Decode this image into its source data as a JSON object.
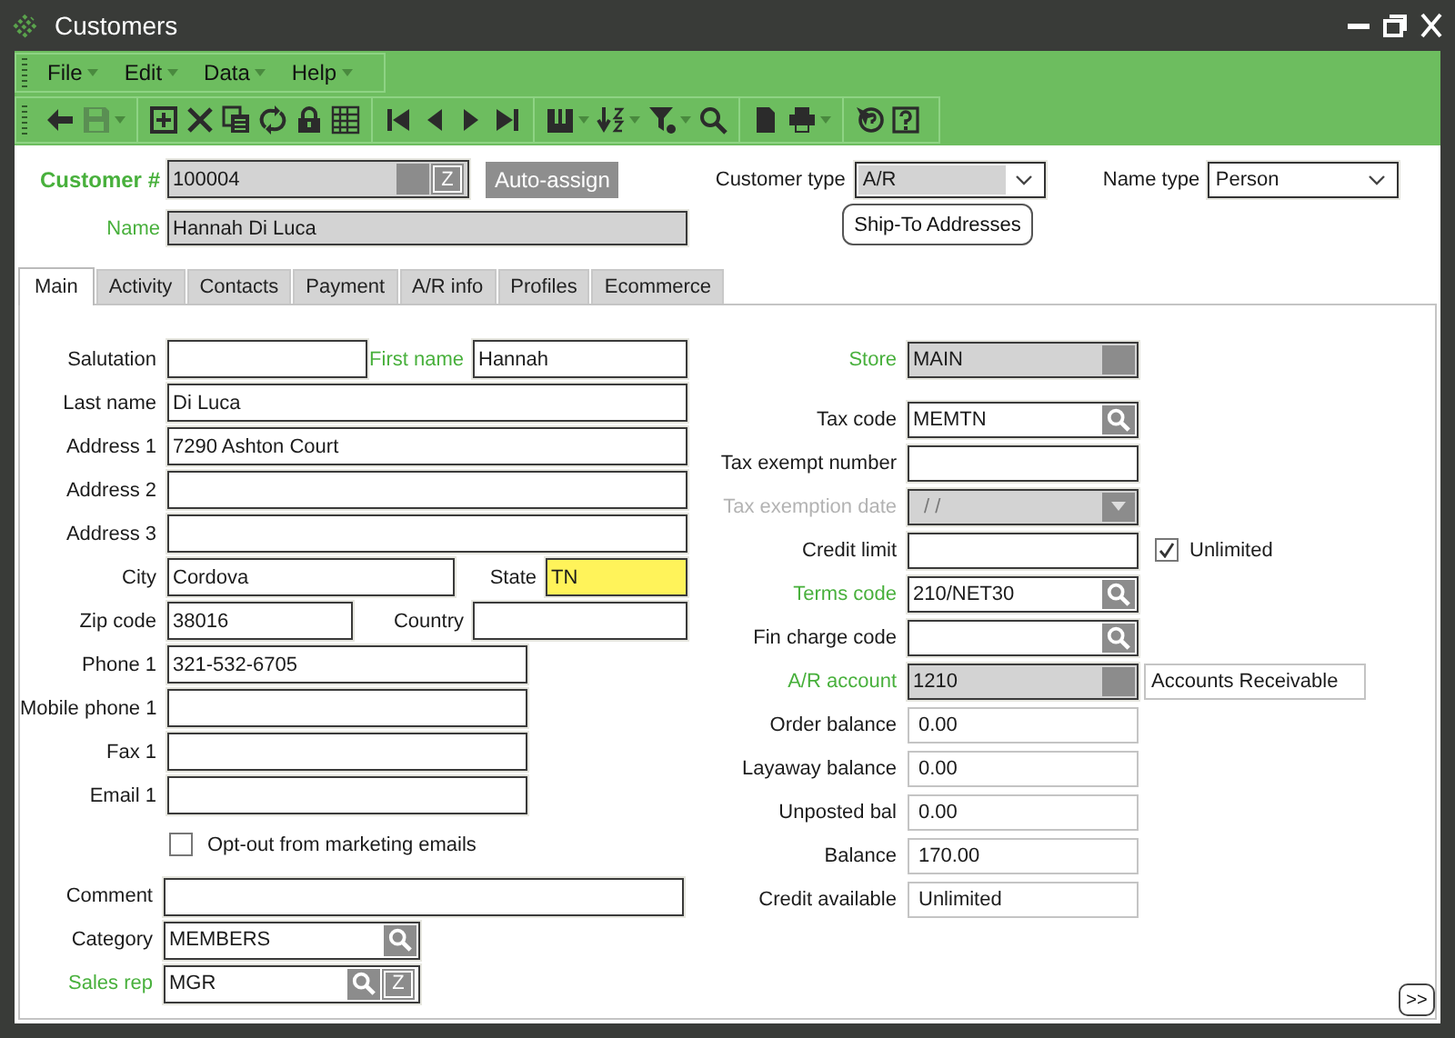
{
  "window": {
    "title": "Customers"
  },
  "menu": [
    {
      "label": "File"
    },
    {
      "label": "Edit"
    },
    {
      "label": "Data"
    },
    {
      "label": "Help"
    }
  ],
  "toolbar": [
    [
      {
        "dropdown": false,
        "disabled": false
      },
      {
        "dropdown": true,
        "disabled": true
      }
    ],
    [
      {
        "dropdown": false,
        "disabled": false
      },
      {
        "dropdown": false,
        "disabled": false
      },
      {
        "dropdown": false,
        "disabled": false
      },
      {
        "dropdown": false,
        "disabled": false
      },
      {
        "dropdown": false,
        "disabled": false
      },
      {
        "dropdown": false,
        "disabled": false
      }
    ],
    [
      {
        "dropdown": false,
        "disabled": false
      },
      {
        "dropdown": false,
        "disabled": false
      },
      {
        "dropdown": false,
        "disabled": false
      },
      {
        "dropdown": false,
        "disabled": false
      }
    ],
    [
      {
        "dropdown": true,
        "disabled": false
      },
      {
        "dropdown": true,
        "disabled": false
      },
      {
        "dropdown": true,
        "disabled": false
      },
      {
        "dropdown": false,
        "disabled": false
      }
    ],
    [
      {
        "dropdown": false,
        "disabled": false
      },
      {
        "dropdown": true,
        "disabled": false
      }
    ],
    [
      {
        "dropdown": false,
        "disabled": false
      },
      {
        "dropdown": false,
        "disabled": false
      }
    ]
  ],
  "header": {
    "customer_number": {
      "label": "Customer #",
      "value": "100004",
      "kind": "locked",
      "required": true,
      "zoom": "Z"
    },
    "auto_assign": "Auto-assign",
    "customer_type": {
      "label": "Customer type",
      "value": "A/R",
      "highlighted": true
    },
    "name_type": {
      "label": "Name type",
      "value": "Person",
      "highlighted": false
    },
    "name": {
      "label": "Name",
      "value": "Hannah Di Luca",
      "kind": "locked_plain",
      "required": true
    },
    "ship_to": "Ship-To Addresses"
  },
  "tabs": [
    {
      "label": "Main",
      "selected": true
    },
    {
      "label": "Activity",
      "selected": false
    },
    {
      "label": "Contacts",
      "selected": false
    },
    {
      "label": "Payment",
      "selected": false
    },
    {
      "label": "A/R info",
      "selected": false
    },
    {
      "label": "Profiles",
      "selected": false
    },
    {
      "label": "Ecommerce",
      "selected": false
    }
  ],
  "left": {
    "rows": [
      {
        "fields": [
          {
            "label": "Salutation",
            "required": false,
            "highlighted": false
          },
          {
            "label": "First name",
            "value": "Hannah",
            "required": true,
            "highlighted": false
          }
        ]
      },
      {
        "fields": [
          {
            "label": "Last name",
            "value": "Di Luca",
            "required": false,
            "highlighted": false
          }
        ]
      },
      {
        "fields": [
          {
            "label": "Address 1",
            "value": "7290 Ashton Court",
            "required": false,
            "highlighted": false
          }
        ]
      },
      {
        "fields": [
          {
            "label": "Address 2",
            "required": false,
            "highlighted": false
          }
        ]
      },
      {
        "fields": [
          {
            "label": "Address 3",
            "required": false,
            "highlighted": false
          }
        ]
      },
      {
        "fields": [
          {
            "label": "City",
            "value": "Cordova",
            "required": false,
            "highlighted": false
          },
          {
            "label": "State",
            "value": "TN",
            "required": false,
            "highlighted": true
          }
        ]
      },
      {
        "fields": [
          {
            "label": "Zip code",
            "value": "38016",
            "required": false,
            "highlighted": false
          },
          {
            "label": "Country",
            "required": false,
            "highlighted": false
          }
        ]
      },
      {
        "fields": [
          {
            "label": "Phone 1",
            "value": "321-532-6705",
            "required": false,
            "highlighted": false
          }
        ]
      },
      {
        "fields": [
          {
            "label": "Mobile phone 1",
            "required": false,
            "highlighted": false
          }
        ]
      },
      {
        "fields": [
          {
            "label": "Fax 1",
            "required": false,
            "highlighted": false
          }
        ]
      },
      {
        "fields": [
          {
            "label": "Email 1",
            "required": false,
            "highlighted": false
          }
        ]
      }
    ],
    "opt_out": {
      "label": "Opt-out from marketing emails",
      "checked": false
    },
    "bottom_fields": [
      {
        "label": "Comment",
        "kind": "text",
        "required": false
      },
      {
        "label": "Category",
        "value": "MEMBERS",
        "kind": "lookup",
        "required": false
      },
      {
        "label": "Sales rep",
        "value": "MGR",
        "kind": "lookup",
        "required": true,
        "zoom": "Z"
      }
    ]
  },
  "right": {
    "rows": [
      {
        "label": "Store",
        "value": "MAIN",
        "kind": "locked",
        "required": true,
        "disabled": false
      },
      {
        "label": "Tax code",
        "value": "MEMTN",
        "kind": "lookup",
        "required": false,
        "disabled": false
      },
      {
        "label": "Tax exempt number",
        "kind": "text",
        "required": false,
        "disabled": false
      },
      {
        "label": "Tax exemption date",
        "value": "/ /",
        "kind": "date",
        "required": false,
        "disabled": true
      },
      {
        "label": "Credit limit",
        "kind": "text",
        "required": false,
        "disabled": false,
        "checkbox": {
          "label": "Unlimited",
          "checked": true
        }
      },
      {
        "label": "Terms code",
        "value": "210/NET30",
        "kind": "lookup",
        "required": true,
        "disabled": false
      },
      {
        "label": "Fin charge code",
        "kind": "lookup",
        "required": false,
        "disabled": false
      },
      {
        "label": "A/R account",
        "value": "1210",
        "kind": "locked",
        "required": true,
        "disabled": false,
        "description": "Accounts Receivable"
      },
      {
        "label": "Order balance",
        "value": "0.00",
        "kind": "readonly",
        "required": false,
        "disabled": false
      },
      {
        "label": "Layaway balance",
        "value": "0.00",
        "kind": "readonly",
        "required": false,
        "disabled": false
      },
      {
        "label": "Unposted bal",
        "value": "0.00",
        "kind": "readonly",
        "required": false,
        "disabled": false
      },
      {
        "label": "Balance",
        "value": "170.00",
        "kind": "readonly",
        "required": false,
        "disabled": false
      },
      {
        "label": "Credit available",
        "value": "Unlimited",
        "kind": "readonly",
        "required": false,
        "disabled": false
      }
    ]
  },
  "more_button": ">>"
}
